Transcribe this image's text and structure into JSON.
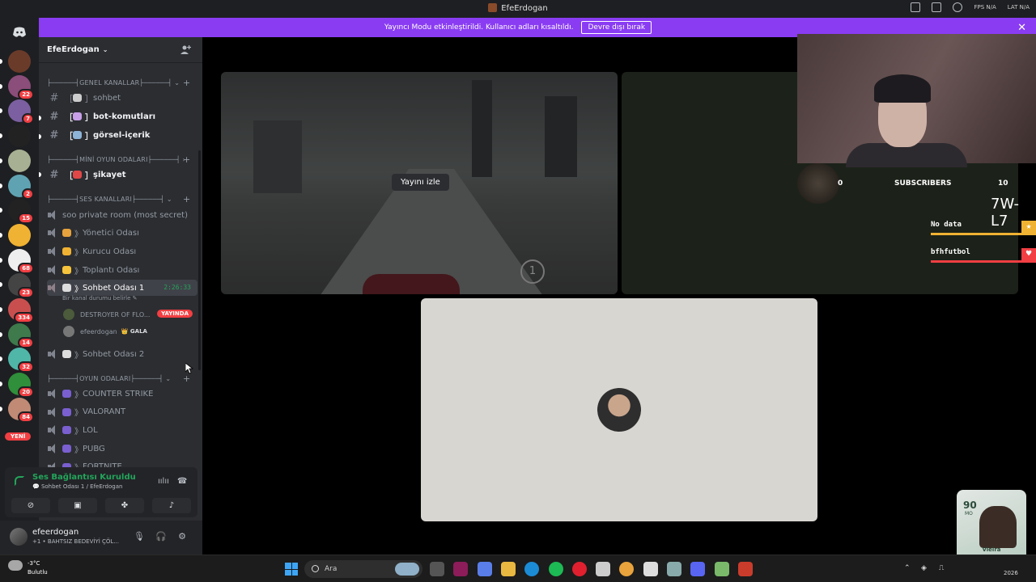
{
  "window": {
    "title": "EfeErdogan"
  },
  "titlebar_right": {
    "fps": "FPS N/A",
    "lat": "LAT N/A"
  },
  "banner": {
    "text": "Yayıncı Modu etkinleştirildi. Kullanıcı adları kısaltıldı.",
    "button": "Devre dışı bırak",
    "close": "✕"
  },
  "servers": [
    {
      "badge": ""
    },
    {
      "badge": "22"
    },
    {
      "badge": "7"
    },
    {
      "badge": ""
    },
    {
      "badge": ""
    },
    {
      "badge": "2"
    },
    {
      "badge": "15"
    },
    {
      "badge": ""
    },
    {
      "badge": "68"
    },
    {
      "badge": "23"
    },
    {
      "badge": "334"
    },
    {
      "badge": "14"
    },
    {
      "badge": "32"
    },
    {
      "badge": "20"
    },
    {
      "badge": "84"
    }
  ],
  "rail_new": "YENİ",
  "guild": {
    "name": "EfeErdogan"
  },
  "categories": {
    "general": "├──────┤GENEL KANALLAR├──────┤",
    "mini": "├──────┤MİNİ OYUN ODALARI├──────┤",
    "voice": "├──────┤SES KANALLARI├──────┤",
    "games": "├──────┤OYUN ODALARI├──────┤"
  },
  "text_channels": [
    {
      "name": "sohbet"
    },
    {
      "name": "bot-komutları"
    },
    {
      "name": "görsel-içerik"
    },
    {
      "name": "şikayet"
    }
  ],
  "voice_channels": {
    "secret": "soo private room (most secret)",
    "yonetici": "Yönetici Odası",
    "kurucu": "Kurucu Odası",
    "toplanti": "Toplantı Odası",
    "sohbet1": "Sohbet Odası 1",
    "sohbet1_timer": "2:26:33",
    "sohbet1_status": "Bir kanal durumu belirle",
    "sohbet2": "Sohbet Odası 2"
  },
  "members": [
    {
      "name": "DESTROYER OF FLO...",
      "badge": "YAYINDA"
    },
    {
      "name": "efeerdogan",
      "tag": "GALA"
    }
  ],
  "game_channels": [
    "COUNTER STRIKE",
    "VALORANT",
    "LOL",
    "PUBG",
    "FORTNITE"
  ],
  "voice_panel": {
    "connected": "Ses Bağlantısı Kuruldu",
    "location": "Sohbet Odası 1 / EfeErdogan"
  },
  "user": {
    "name": "efeerdogan",
    "status": "+1 • BAHTSIZ BEDEVİYİ ÇÖL..."
  },
  "stream": {
    "watch_label": "Yayını izle",
    "speed": "1"
  },
  "overlay": {
    "subs_count": "0",
    "subs_label": "SUBSCRIBERS",
    "subs_goal": "10",
    "score": "7W-L7",
    "alert1": "No data",
    "alert2": "bfhfutbol"
  },
  "fut_card": {
    "rating": "90",
    "position": "MO",
    "player": "Vieira"
  },
  "taskbar": {
    "temp": "-3°C",
    "weather": "Bulutlu",
    "search": "Ara",
    "date": "2026"
  },
  "colors": {
    "accent": "#8a3cf3",
    "online": "#23a55a",
    "danger": "#f23f43"
  }
}
